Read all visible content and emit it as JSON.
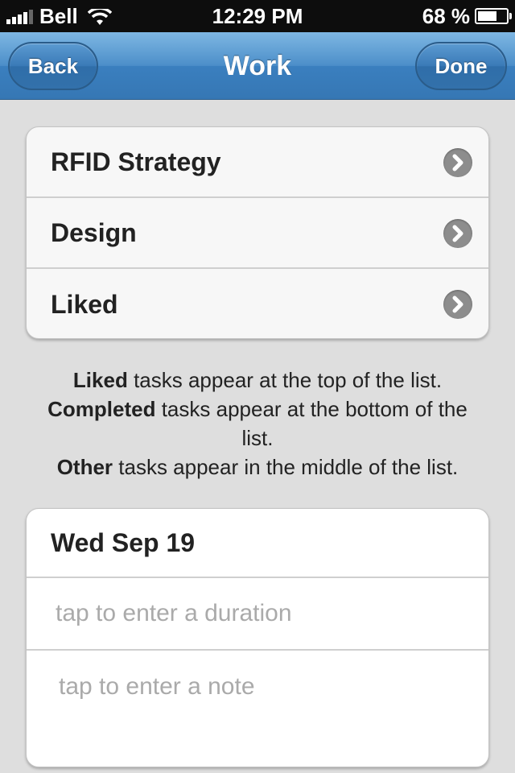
{
  "status_bar": {
    "carrier": "Bell",
    "time": "12:29 PM",
    "battery": "68 %",
    "battery_level": 0.68
  },
  "nav": {
    "back_label": "Back",
    "title": "Work",
    "done_label": "Done"
  },
  "categories": [
    {
      "label": "RFID Strategy"
    },
    {
      "label": "Design"
    },
    {
      "label": "Liked"
    }
  ],
  "info": {
    "line1_bold": "Liked",
    "line1_rest": " tasks appear at the top of the list.",
    "line2_bold": "Completed",
    "line2_rest": " tasks appear at the bottom of the list.",
    "line3_bold": "Other",
    "line3_rest": " tasks appear in the middle of the list."
  },
  "detail": {
    "date": "Wed Sep 19",
    "duration_placeholder": "tap to enter a duration",
    "note_placeholder": "tap to enter a note"
  },
  "colors": {
    "nav_blue": "#4c8ec9",
    "background": "#dedede",
    "chevron": "#8d8d8d"
  }
}
